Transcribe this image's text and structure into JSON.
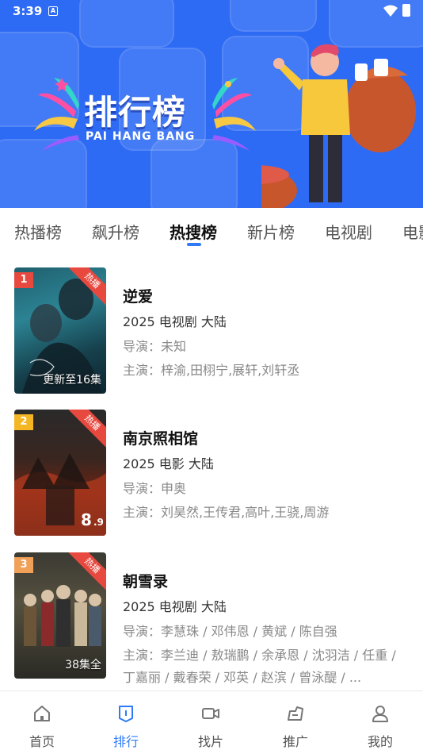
{
  "status_bar": {
    "time": "3:39",
    "indicator": "A"
  },
  "banner": {
    "title": "排行榜",
    "subtitle": "PAI HANG BANG"
  },
  "tabs": [
    {
      "label": "热播榜",
      "active": false
    },
    {
      "label": "飙升榜",
      "active": false
    },
    {
      "label": "热搜榜",
      "active": true
    },
    {
      "label": "新片榜",
      "active": false
    },
    {
      "label": "电视剧",
      "active": false
    },
    {
      "label": "电影",
      "active": false
    }
  ],
  "items": [
    {
      "rank": "1",
      "hot_tag": "热播",
      "episode": "更新至16集",
      "title": "逆爱",
      "meta": "2025  电视剧  大陆",
      "director": "导演：未知",
      "cast": "主演：梓渝,田栩宁,展轩,刘轩丞",
      "rank_color": "#e8493f"
    },
    {
      "rank": "2",
      "hot_tag": "热播",
      "episode": "",
      "title": "南京照相馆",
      "meta": "2025  电影  大陆",
      "director": "导演：申奥",
      "cast": "主演：刘昊然,王传君,高叶,王骁,周游",
      "rank_color": "#f5b623"
    },
    {
      "rank": "3",
      "hot_tag": "热播",
      "episode": "38集全",
      "title": "朝雪录",
      "meta": "2025  电视剧  大陆",
      "director": "导演：李慧珠 / 邓伟恩 / 黄斌 / 陈自强",
      "cast": "主演：李兰迪 / 敖瑞鹏 / 余承恩 / 沈羽洁 / 任重 / 丁嘉丽 / 戴春荣 / 邓英 / 赵滨 / 曾泳醍 / ...",
      "rank_color": "#f0a057"
    }
  ],
  "bottom_nav": [
    {
      "label": "首页",
      "icon": "home-icon",
      "active": false
    },
    {
      "label": "排行",
      "icon": "ranking-icon",
      "active": true
    },
    {
      "label": "找片",
      "icon": "video-camera-icon",
      "active": false
    },
    {
      "label": "推广",
      "icon": "share-icon",
      "active": false
    },
    {
      "label": "我的",
      "icon": "user-icon",
      "active": false
    }
  ],
  "colors": {
    "banner_bg": "#2e6bf4",
    "accent": "#2f7bf7",
    "hot_tag": "#e8493f"
  }
}
